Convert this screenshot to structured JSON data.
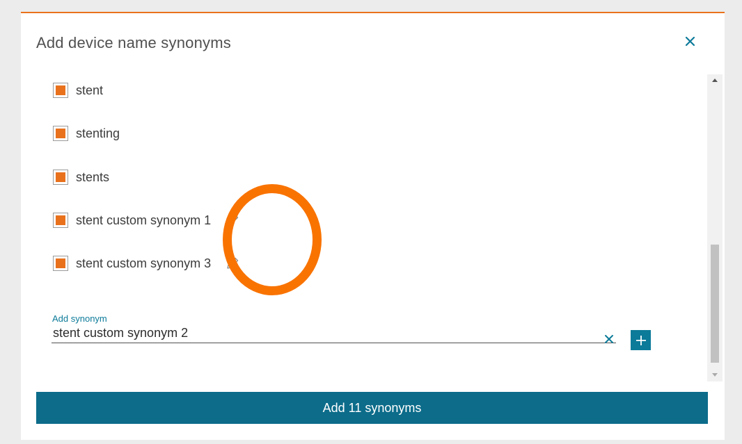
{
  "dialog": {
    "title": "Add device name synonyms",
    "close_icon": "close-icon",
    "accent_color": "#e9711c",
    "primary_color": "#0c7a99"
  },
  "synonyms": [
    {
      "label": "stent",
      "checked": true,
      "editable": false
    },
    {
      "label": "stenting",
      "checked": true,
      "editable": false
    },
    {
      "label": "stents",
      "checked": true,
      "editable": false
    },
    {
      "label": "stent custom synonym 1",
      "checked": true,
      "editable": true
    },
    {
      "label": "stent custom synonym 3",
      "checked": true,
      "editable": true
    }
  ],
  "add_field": {
    "label": "Add synonym",
    "value": "stent custom synonym 2",
    "clear_icon": "clear-icon",
    "add_icon": "plus-icon"
  },
  "submit": {
    "label": "Add 11 synonyms"
  },
  "annotation": {
    "shape": "ellipse",
    "color": "#f97300"
  }
}
